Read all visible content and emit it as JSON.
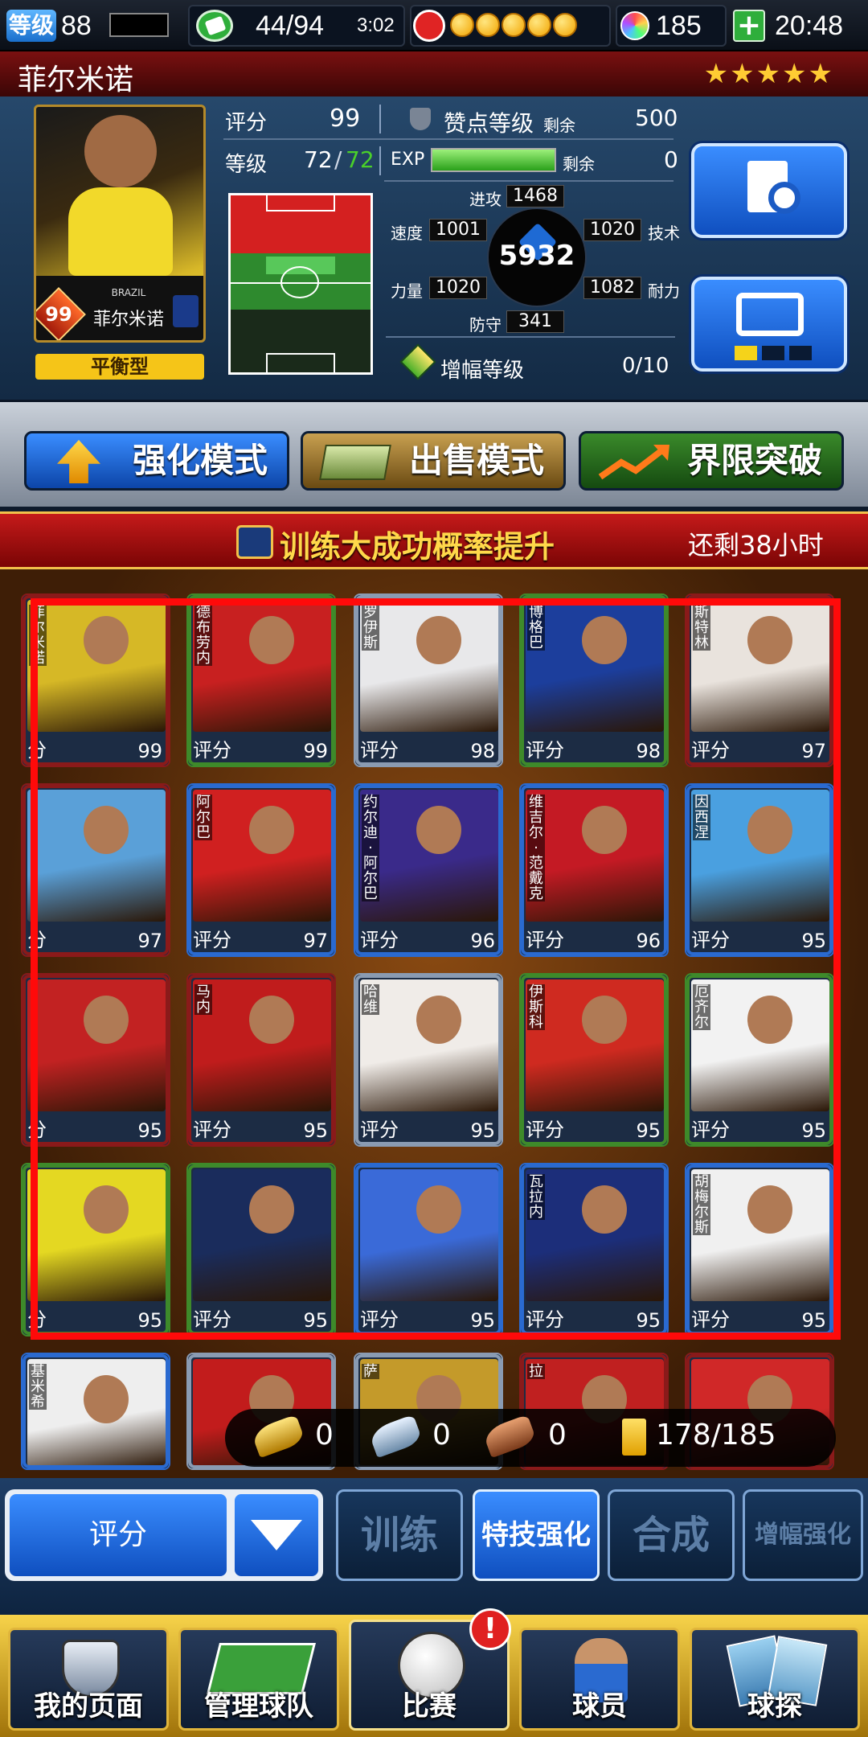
{
  "status_bar": {
    "level_label": "等级",
    "level_value": "88",
    "energy": "44/94",
    "energy_timer": "3:02",
    "gems": "185",
    "time": "20:48"
  },
  "player": {
    "name": "菲尔米诺",
    "stars": "★★★★★",
    "card_rating": "99",
    "card_country": "BRAZIL",
    "card_name": "菲尔米诺",
    "style": "平衡型",
    "rating_label": "评分",
    "rating_value": "99",
    "praise_label": "赞点等级",
    "praise_remaining_label": "剩余",
    "praise_remaining": "500",
    "level_label": "等级",
    "level_current": "72",
    "level_max": "72",
    "exp_label": "EXP",
    "exp_remaining_label": "剩余",
    "exp_remaining": "0",
    "exp_fill": 1.0,
    "total": "5932",
    "attack_label": "进攻",
    "attack": "1468",
    "speed_label": "速度",
    "speed": "1001",
    "skill_label": "技术",
    "skill": "1020",
    "power_label": "力量",
    "power": "1020",
    "stamina_label": "耐力",
    "stamina": "1082",
    "defense_label": "防守",
    "defense": "341",
    "boost_label": "增幅等级",
    "boost_value": "0/10"
  },
  "modes": [
    {
      "label": "强化模式",
      "icon": "arrows-up-icon"
    },
    {
      "label": "出售模式",
      "icon": "cash-icon"
    },
    {
      "label": "界限突破",
      "icon": "trend-up-icon"
    }
  ],
  "banner": {
    "title": "训练大成功概率提升",
    "remaining": "还剩38小时"
  },
  "cards": [
    {
      "name": "菲尔米诺",
      "label": "分",
      "value": "99",
      "frame": "#8a1a1a",
      "bg": "#d6b826"
    },
    {
      "name": "德布劳内",
      "label": "评分",
      "value": "99",
      "frame": "#3e8a2a",
      "bg": "#c82020"
    },
    {
      "name": "罗伊斯",
      "label": "评分",
      "value": "98",
      "frame": "#8a9bb2",
      "bg": "#e8e8ea"
    },
    {
      "name": "博格巴",
      "label": "评分",
      "value": "98",
      "frame": "#3e8a2a",
      "bg": "#1c3e9c"
    },
    {
      "name": "斯特林",
      "label": "评分",
      "value": "97",
      "frame": "#8a1a1a",
      "bg": "#e9e3dd"
    },
    {
      "name": "",
      "label": "分",
      "value": "97",
      "frame": "#8a1a1a",
      "bg": "#5aa0d8"
    },
    {
      "name": "阿尔巴",
      "label": "评分",
      "value": "97",
      "frame": "#2a6ad0",
      "bg": "#d02020"
    },
    {
      "name": "约尔迪·阿尔巴",
      "label": "评分",
      "value": "96",
      "frame": "#2a6ad0",
      "bg": "#3a2a8a"
    },
    {
      "name": "维吉尔·范戴克",
      "label": "评分",
      "value": "96",
      "frame": "#2a6ad0",
      "bg": "#c41a24"
    },
    {
      "name": "因西涅",
      "label": "评分",
      "value": "95",
      "frame": "#2a6ad0",
      "bg": "#4aa0e0"
    },
    {
      "name": "",
      "label": "分",
      "value": "95",
      "frame": "#8a1a1a",
      "bg": "#c22222"
    },
    {
      "name": "马内",
      "label": "评分",
      "value": "95",
      "frame": "#8a1a1a",
      "bg": "#c01c1c"
    },
    {
      "name": "哈维",
      "label": "评分",
      "value": "95",
      "frame": "#8a9bb2",
      "bg": "#f0ece8"
    },
    {
      "name": "伊斯科",
      "label": "评分",
      "value": "95",
      "frame": "#3e8a2a",
      "bg": "#cf2a20"
    },
    {
      "name": "厄齐尔",
      "label": "评分",
      "value": "95",
      "frame": "#3e8a2a",
      "bg": "#f2f2f2"
    },
    {
      "name": "",
      "label": "分",
      "value": "95",
      "frame": "#3e8a2a",
      "bg": "#e4d822"
    },
    {
      "name": "",
      "label": "评分",
      "value": "95",
      "frame": "#3e8a2a",
      "bg": "#1a2c5c"
    },
    {
      "name": "",
      "label": "评分",
      "value": "95",
      "frame": "#2a6ad0",
      "bg": "#3a6ad8"
    },
    {
      "name": "瓦拉内",
      "label": "评分",
      "value": "95",
      "frame": "#2a6ad0",
      "bg": "#1c2e7a"
    },
    {
      "name": "胡梅尔斯",
      "label": "评分",
      "value": "95",
      "frame": "#2a6ad0",
      "bg": "#f0f0f0"
    },
    {
      "name": "基米希",
      "label": "",
      "value": "",
      "frame": "#2a6ad0",
      "bg": "#eeeeee"
    },
    {
      "name": "",
      "label": "",
      "value": "",
      "frame": "#8a9bb2",
      "bg": "#c21c1c"
    },
    {
      "name": "萨",
      "label": "",
      "value": "",
      "frame": "#8a9bb2",
      "bg": "#c49a2a"
    },
    {
      "name": "拉",
      "label": "",
      "value": "",
      "frame": "#8a1a1a",
      "bg": "#c02020"
    },
    {
      "name": "",
      "label": "",
      "value": "",
      "frame": "#8a1a1a",
      "bg": "#d02828"
    }
  ],
  "resources": {
    "gold_shoes": "0",
    "silver_shoes": "0",
    "bronze_shoes": "0",
    "card_capacity": "178/185"
  },
  "controls": {
    "sort_label": "评分",
    "train": "训练",
    "skill_up": "特技强化",
    "merge": "合成",
    "boost_up": "增幅强化"
  },
  "nav": [
    {
      "label": "我的页面",
      "icon": "shield-icon"
    },
    {
      "label": "管理球队",
      "icon": "pitch-icon"
    },
    {
      "label": "比赛",
      "icon": "soccer-ball-icon"
    },
    {
      "label": "球员",
      "icon": "player-icon"
    },
    {
      "label": "球探",
      "icon": "scout-cards-icon"
    }
  ],
  "colors": {
    "accent_blue": "#1a6fcc",
    "banner_red": "#c51a1a",
    "highlight_red": "#ff0a0a",
    "gold": "#f2c14b",
    "exp_green": "#4ad02a"
  }
}
